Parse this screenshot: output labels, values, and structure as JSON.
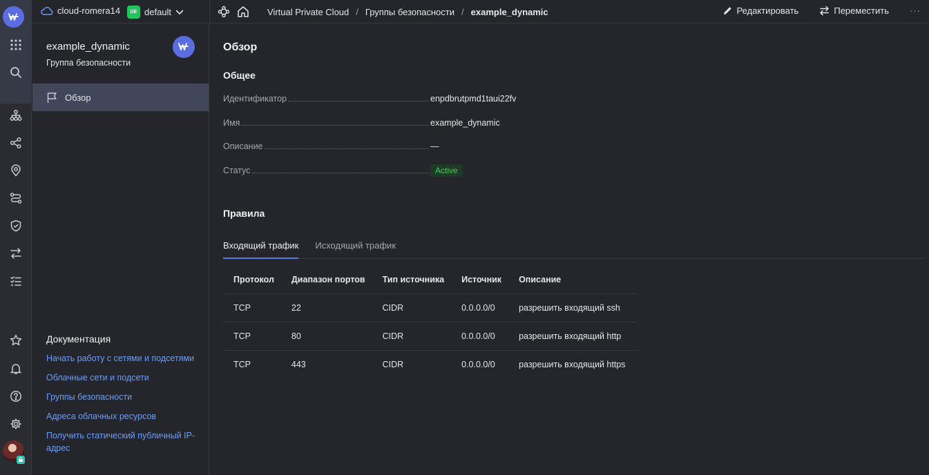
{
  "topbar": {
    "cloud_name": "cloud-romera14",
    "folder_badge": "DE",
    "folder_name": "default",
    "breadcrumbs": [
      "Virtual Private Cloud",
      "Группы безопасности",
      "example_dynamic"
    ],
    "breadcrumb_separator": "/",
    "edit_label": "Редактировать",
    "move_label": "Переместить",
    "more_label": "···"
  },
  "sidebar": {
    "title": "example_dynamic",
    "subtitle": "Группа безопасности",
    "nav_item": "Обзор",
    "docs_title": "Документация",
    "docs_links": [
      "Начать работу с сетями и подсетями",
      "Облачные сети и подсети",
      "Группы безопасности",
      "Адреса облачных ресурсов",
      "Получить статический публичный IP-адрес"
    ]
  },
  "main": {
    "heading": "Обзор",
    "general_heading": "Общее",
    "properties": [
      {
        "label": "Идентификатор",
        "value": "enpdbrutpmd1taui22fv"
      },
      {
        "label": "Имя",
        "value": "example_dynamic"
      },
      {
        "label": "Описание",
        "value": "—"
      },
      {
        "label": "Статус",
        "value": "Active"
      }
    ],
    "rules_heading": "Правила",
    "tabs": [
      "Входящий трафик",
      "Исходящий трафик"
    ],
    "table": {
      "headers": [
        "Протокол",
        "Диапазон портов",
        "Тип источника",
        "Источник",
        "Описание"
      ],
      "rows": [
        [
          "TCP",
          "22",
          "CIDR",
          "0.0.0.0/0",
          "разрешить входящий ssh"
        ],
        [
          "TCP",
          "80",
          "CIDR",
          "0.0.0.0/0",
          "разрешить входящий http"
        ],
        [
          "TCP",
          "443",
          "CIDR",
          "0.0.0.0/0",
          "разрешить входящий https"
        ]
      ]
    }
  },
  "colors": {
    "background": "#25262b",
    "accent": "#5b6ee1",
    "link": "#6f9cf2",
    "status_active": "#3fcf62",
    "folder_badge": "#22c55e"
  },
  "rail_icons": [
    "services-grid-icon",
    "search-icon",
    "network-icon",
    "share-icon",
    "location-pin-icon",
    "routes-icon",
    "shield-icon",
    "transfer-icon",
    "checklist-icon",
    "star-icon",
    "bell-icon",
    "help-icon",
    "settings-icon"
  ]
}
